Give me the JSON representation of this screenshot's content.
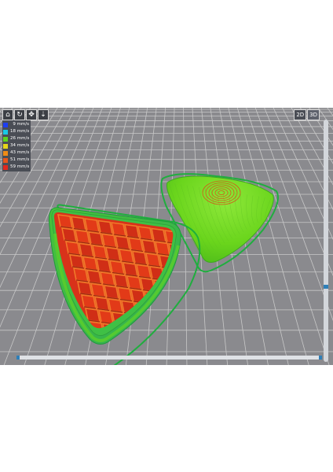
{
  "viewer": {
    "toolbar": [
      {
        "name": "home-icon",
        "glyph": "⌂"
      },
      {
        "name": "rotate-icon",
        "glyph": "↻"
      },
      {
        "name": "move-icon",
        "glyph": "✥"
      },
      {
        "name": "zoom-icon",
        "glyph": "⇣"
      }
    ],
    "view_2d": "2D",
    "view_3d": "3D",
    "active_view": "3D"
  },
  "legend": [
    {
      "label": "9 mm/s",
      "color": "#1e3ef2"
    },
    {
      "label": "18 mm/s",
      "color": "#19c8e6"
    },
    {
      "label": "26 mm/s",
      "color": "#5fd21e"
    },
    {
      "label": "34 mm/s",
      "color": "#e6d51a"
    },
    {
      "label": "43 mm/s",
      "color": "#f08c16"
    },
    {
      "label": "51 mm/s",
      "color": "#e8561b"
    },
    {
      "label": "59 mm/s",
      "color": "#e0281e"
    }
  ],
  "colors": {
    "grid_background": "#8a8a8e",
    "grid_line": "#c8c8c8",
    "perimeter": "#22b04a",
    "wall": "#6dd61a",
    "infill": "#e84a16",
    "scrollbar_accent": "#2e7fb8"
  }
}
